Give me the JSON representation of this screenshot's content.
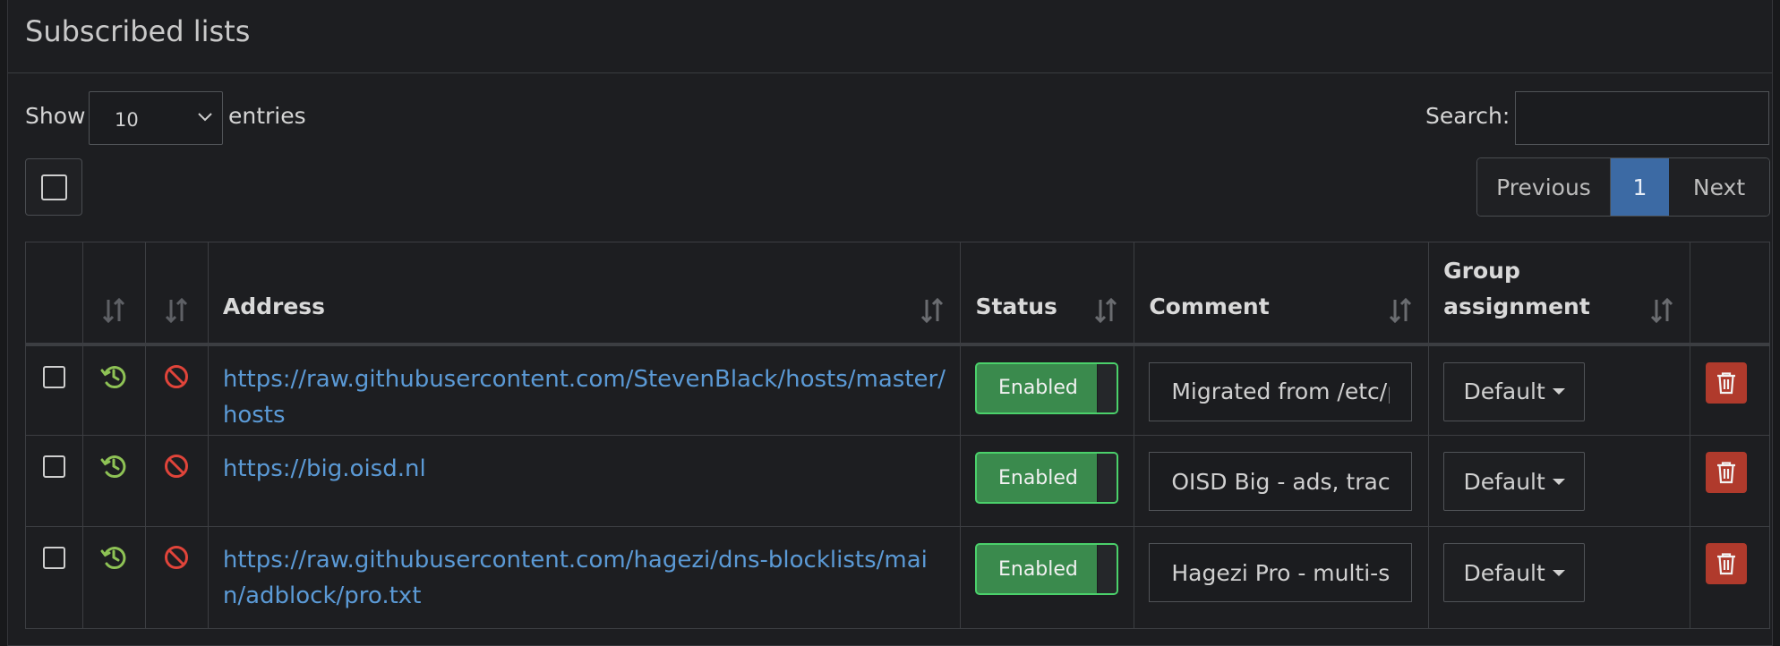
{
  "panel": {
    "title": "Subscribed lists"
  },
  "controls": {
    "show_label": "Show",
    "page_size": "10",
    "entries_label": "entries",
    "search_label": "Search:",
    "search_value": ""
  },
  "pagination": {
    "previous": "Previous",
    "current": "1",
    "next": "Next"
  },
  "table": {
    "headers": {
      "address": "Address",
      "status": "Status",
      "comment": "Comment",
      "group_line1": "Group",
      "group_line2": "assignment"
    },
    "rows": [
      {
        "address": "https://raw.githubusercontent.com/StevenBlack/hosts/master/hosts",
        "status": "Enabled",
        "comment": "Migrated from /etc/pihole/adlists.list",
        "group": "Default"
      },
      {
        "address": "https://big.oisd.nl",
        "status": "Enabled",
        "comment": "OISD Big - ads, tracking, malware",
        "group": "Default"
      },
      {
        "address": "https://raw.githubusercontent.com/hagezi/dns-blocklists/main/adblock/pro.txt",
        "status": "Enabled",
        "comment": "Hagezi Pro - multi-source blocklist",
        "group": "Default"
      }
    ]
  },
  "icons": {
    "history": "history-icon",
    "disabled": "no-entry-icon",
    "delete": "trash-icon",
    "sort": "sort-icon"
  },
  "colors": {
    "link": "#5b9ad6",
    "enabled": "#3a8a4d",
    "history_icon": "#8ec255",
    "block_icon": "#e0443a",
    "delete": "#b03a2c",
    "page_active": "#3c6aa4"
  }
}
